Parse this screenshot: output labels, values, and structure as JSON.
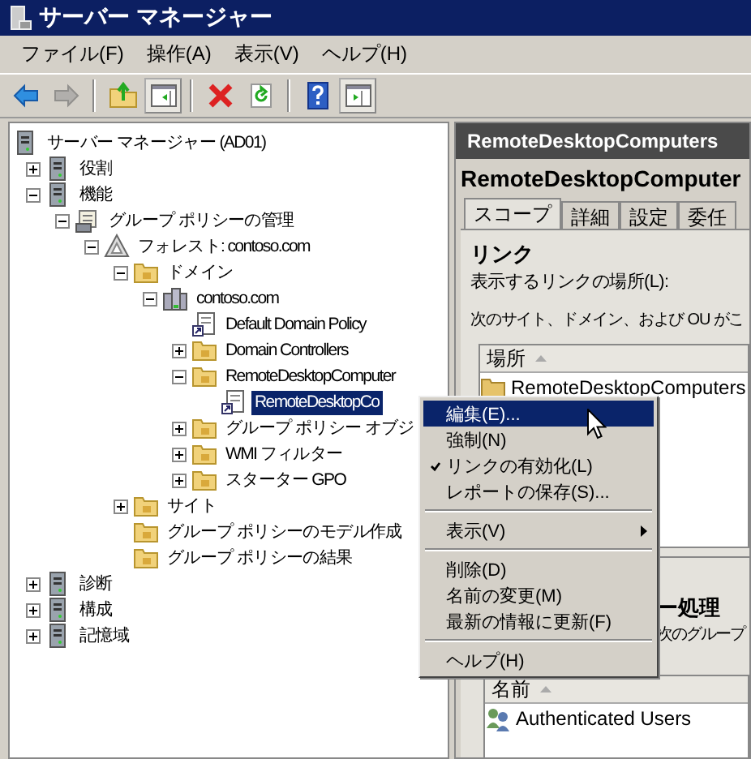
{
  "window": {
    "title": "サーバー マネージャー"
  },
  "menu_bar": [
    "ファイル(F)",
    "操作(A)",
    "表示(V)",
    "ヘルプ(H)"
  ],
  "toolbar": [
    {
      "kind": "back",
      "disabled": false,
      "pressed": false
    },
    {
      "kind": "forward",
      "disabled": true,
      "pressed": false
    },
    {
      "kind": "separator"
    },
    {
      "kind": "up",
      "disabled": false,
      "pressed": false
    },
    {
      "kind": "tree",
      "disabled": false,
      "pressed": true
    },
    {
      "kind": "separator"
    },
    {
      "kind": "delete",
      "disabled": false,
      "pressed": false
    },
    {
      "kind": "refresh",
      "disabled": false,
      "pressed": false
    },
    {
      "kind": "separator"
    },
    {
      "kind": "help",
      "disabled": false,
      "pressed": false
    },
    {
      "kind": "actions",
      "disabled": false,
      "pressed": true
    }
  ],
  "tree": {
    "label": "サーバー マネージャー (AD01)",
    "kind": "server",
    "selected": false,
    "children": [
      {
        "label": "役割",
        "kind": "server",
        "expanded": false,
        "selected": false
      },
      {
        "label": "機能",
        "kind": "server",
        "expanded": true,
        "selected": false,
        "children": [
          {
            "label": "グループ ポリシーの管理",
            "kind": "gpm",
            "expanded": true,
            "selected": false,
            "children": [
              {
                "label": "フォレスト: contoso.com",
                "kind": "forest",
                "expanded": true,
                "selected": false,
                "children": [
                  {
                    "label": "ドメイン",
                    "kind": "folder",
                    "expanded": true,
                    "selected": false,
                    "children": [
                      {
                        "label": "contoso.com",
                        "kind": "domain",
                        "expanded": true,
                        "selected": false,
                        "children": [
                          {
                            "label": "Default Domain Policy",
                            "kind": "doc",
                            "selected": false
                          },
                          {
                            "label": "Domain Controllers",
                            "kind": "folder",
                            "expanded": false,
                            "selected": false
                          },
                          {
                            "label": "RemoteDesktopComputer",
                            "kind": "folder",
                            "expanded": true,
                            "selected": false,
                            "children": [
                              {
                                "label": "RemoteDesktopCo",
                                "kind": "doc",
                                "selected": true
                              }
                            ]
                          },
                          {
                            "label": "グループ ポリシー オブジ",
                            "kind": "folder",
                            "expanded": false,
                            "selected": false
                          },
                          {
                            "label": "WMI フィルター",
                            "kind": "folder",
                            "expanded": false,
                            "selected": false
                          },
                          {
                            "label": "スターター GPO",
                            "kind": "folder",
                            "expanded": false,
                            "selected": false
                          }
                        ]
                      }
                    ]
                  },
                  {
                    "label": "サイト",
                    "kind": "folder",
                    "expanded": false,
                    "selected": false
                  },
                  {
                    "label": "グループ ポリシーのモデル作成",
                    "kind": "folder",
                    "selected": false
                  },
                  {
                    "label": "グループ ポリシーの結果",
                    "kind": "folder",
                    "selected": false
                  }
                ]
              }
            ]
          }
        ]
      },
      {
        "label": "診断",
        "kind": "server",
        "expanded": false,
        "selected": false
      },
      {
        "label": "構成",
        "kind": "server",
        "expanded": false,
        "selected": false
      },
      {
        "label": "記憶域",
        "kind": "server",
        "expanded": false,
        "selected": false
      }
    ]
  },
  "details": {
    "header": "RemoteDesktopComputers",
    "title": "RemoteDesktopComputer",
    "tabs": [
      {
        "label": "スコープ",
        "selected": true
      },
      {
        "label": "詳細",
        "selected": false
      },
      {
        "label": "設定",
        "selected": false
      },
      {
        "label": "委任",
        "selected": false
      }
    ],
    "links_heading": "リンク",
    "links_label": "表示するリンクの場所(L):",
    "links_note": "次のサイト、ドメイン、および OU がこ",
    "links_table": {
      "columns": [
        "場所"
      ],
      "rows": [
        "RemoteDesktopComputers"
      ]
    },
    "filter_heading": "ー処理",
    "filter_note": "次のグループ",
    "filter_table": {
      "columns": [
        "名前"
      ],
      "rows": [
        "Authenticated Users"
      ]
    }
  },
  "context_menu": [
    {
      "kind": "item",
      "label": "編集(E)...",
      "selected": true,
      "checked": false,
      "submenu": false
    },
    {
      "kind": "item",
      "label": "強制(N)",
      "selected": false,
      "checked": false,
      "submenu": false
    },
    {
      "kind": "item",
      "label": "リンクの有効化(L)",
      "selected": false,
      "checked": true,
      "submenu": false
    },
    {
      "kind": "item",
      "label": "レポートの保存(S)...",
      "selected": false,
      "checked": false,
      "submenu": false
    },
    {
      "kind": "separator"
    },
    {
      "kind": "item",
      "label": "表示(V)",
      "selected": false,
      "checked": false,
      "submenu": true
    },
    {
      "kind": "separator"
    },
    {
      "kind": "item",
      "label": "削除(D)",
      "selected": false,
      "checked": false,
      "submenu": false
    },
    {
      "kind": "item",
      "label": "名前の変更(M)",
      "selected": false,
      "checked": false,
      "submenu": false
    },
    {
      "kind": "item",
      "label": "最新の情報に更新(F)",
      "selected": false,
      "checked": false,
      "submenu": false
    },
    {
      "kind": "separator"
    },
    {
      "kind": "item",
      "label": "ヘルプ(H)",
      "selected": false,
      "checked": false,
      "submenu": false
    }
  ]
}
